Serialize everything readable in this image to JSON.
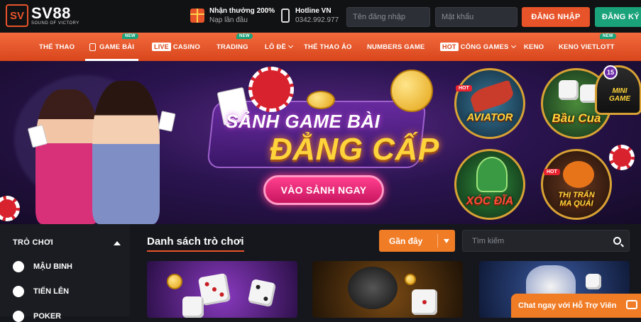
{
  "brand": {
    "name": "SV88",
    "tagline": "SOUND OF VICTORY",
    "accent": "#e8542a",
    "green": "#1aa37a"
  },
  "header": {
    "promo_title": "Nhận thưởng 200%",
    "promo_sub": "Nạp lần đầu",
    "hotline_label": "Hotline VN",
    "hotline_number": "0342.992.977",
    "username_placeholder": "Tên đăng nhập",
    "password_placeholder": "Mật khẩu",
    "login_label": "ĐĂNG NHẬP",
    "register_label": "ĐĂNG KÝ"
  },
  "nav": {
    "new_badge": "NEW",
    "hot_tag": "HOT",
    "live_tag": "LIVE",
    "items": [
      {
        "label": "THỂ THAO"
      },
      {
        "label": "GAME BÀI"
      },
      {
        "label": "CASINO"
      },
      {
        "label": "TRADING"
      },
      {
        "label": "LÔ ĐỀ"
      },
      {
        "label": "THỂ THAO ẢO"
      },
      {
        "label": "NUMBERS GAME"
      },
      {
        "label": "CỔNG GAMES"
      },
      {
        "label": "KENO"
      },
      {
        "label": "KENO VIETLOTT"
      }
    ]
  },
  "banner": {
    "title_line1": "SẢNH GAME BÀI",
    "title_line2": "ĐẲNG CẤP",
    "cta_label": "VÀO SẢNH NGAY",
    "games": [
      {
        "label": "AVIATOR",
        "badge": "HOT"
      },
      {
        "label": "Bầu Cua",
        "badge": ""
      },
      {
        "label": "MINI GAME",
        "badge": "15"
      },
      {
        "label": "XÓC ĐĨA",
        "badge": ""
      },
      {
        "label": "THỊ TRẤN MA QUÁI",
        "badge": "HOT"
      }
    ]
  },
  "sidebar": {
    "heading": "TRÒ CHƠI",
    "items": [
      {
        "label": "MẬU BINH"
      },
      {
        "label": "TIẾN LÊN"
      },
      {
        "label": "POKER"
      }
    ]
  },
  "main": {
    "list_title": "Danh sách trò chơi",
    "sort_label": "Gần đây",
    "search_placeholder": "Tìm kiếm"
  },
  "chat": {
    "label": "Chat ngay với Hỗ Trợ Viên"
  }
}
